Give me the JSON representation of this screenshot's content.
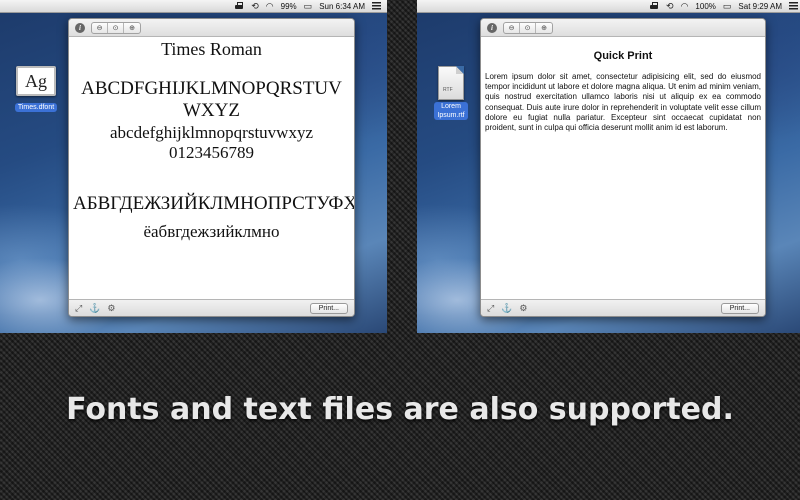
{
  "left": {
    "menubar": {
      "battery": "99%",
      "clock": "Sun 6:34 AM"
    },
    "desktop_icon": {
      "glyph": "Ag",
      "label": "Times.dfont"
    },
    "panel": {
      "font_name": "Times Roman",
      "upper": "ABCDFGHIJKLMNOPQRSTUVWXYZ",
      "lower": "abcdefghijklmnopqrstuvwxyz",
      "digits": "0123456789",
      "cyrillic_upper": "АБВГДЕЖЗИЙКЛМНОПРСТУФХЦЧШЩЪЫЬЭЮЯЁ",
      "cyrillic_lower": "ёабвгдежзийклмно",
      "print_label": "Print..."
    }
  },
  "right": {
    "menubar": {
      "battery": "100%",
      "clock": "Sat 9:29 AM"
    },
    "desktop_icon": {
      "tag": "RTF",
      "label_line1": "Lorem",
      "label_line2": "Ipsum.rtf"
    },
    "panel": {
      "title": "Quick Print",
      "body": "Lorem ipsum dolor sit amet, consectetur adipisicing elit, sed do eiusmod tempor incididunt ut labore et dolore magna aliqua. Ut enim ad minim veniam, quis nostrud exercitation ullamco laboris nisi ut aliquip ex ea commodo consequat. Duis aute irure dolor in reprehenderit in voluptate velit esse cillum dolore eu fugiat nulla pariatur. Excepteur sint occaecat cupidatat non proident, sunt in culpa qui officia deserunt mollit anim id est laborum.",
      "print_label": "Print..."
    }
  },
  "caption": "Fonts and text files are also supported.",
  "icons": {
    "menubar": [
      "printer-icon",
      "time-machine-icon",
      "wifi-icon",
      "battery-icon",
      "notification-list-icon"
    ],
    "toolbar": [
      "info-icon",
      "zoom-out-icon",
      "zoom-actual-icon",
      "zoom-in-icon"
    ],
    "footer": [
      "resize-icon",
      "anchor-icon",
      "gear-icon"
    ]
  },
  "colors": {
    "selection_label": "#3b71d6",
    "backdrop": "#2b2b2b",
    "caption_text": "#e8e8e8"
  }
}
